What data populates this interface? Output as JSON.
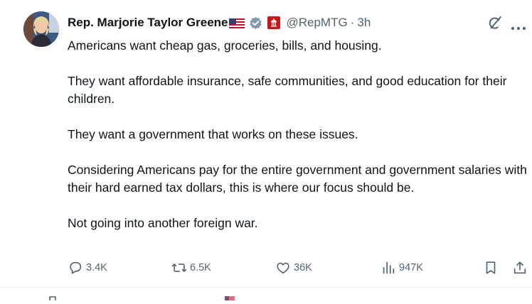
{
  "tweet": {
    "author_name": "Rep. Marjorie Taylor Greene",
    "handle": "@RepMTG",
    "separator": "·",
    "time": "3h",
    "paragraphs": [
      "Americans want cheap gas, groceries, bills, and housing.",
      "They want affordable insurance, safe communities, and good education for their children.",
      "They want a government that works on these issues.",
      "Considering Americans pay for the entire government and government salaries with their hard earned tax dollars, this is where our focus should be.",
      "Not going into another foreign war."
    ],
    "replies": "3.4K",
    "reposts": "6.5K",
    "likes": "36K",
    "views": "947K"
  },
  "icons": [
    "us-flag-icon",
    "verified-badge-icon",
    "affiliation-icon",
    "grok-icon",
    "more-icon",
    "reply-icon",
    "repost-icon",
    "like-icon",
    "views-icon",
    "bookmark-icon",
    "share-icon"
  ],
  "colors": {
    "text": "#0f1419",
    "secondary": "#536471",
    "verified_gray": "#829aab",
    "affiliation_red": "#c5171c",
    "divider": "#eff3f4"
  }
}
